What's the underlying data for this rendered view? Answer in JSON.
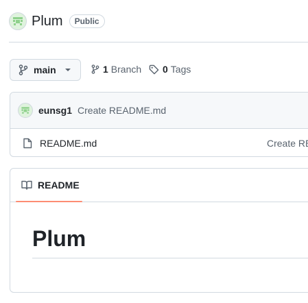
{
  "repo": {
    "name": "Plum",
    "visibility": "Public"
  },
  "branch": {
    "current": "main",
    "branch_count": "1",
    "branch_label": "Branch",
    "tag_count": "0",
    "tag_label": "Tags"
  },
  "latest_commit": {
    "author": "eunsg1",
    "message": "Create README.md"
  },
  "files": [
    {
      "name": "README.md",
      "commit": "Create README.md"
    }
  ],
  "readme": {
    "tab_label": "README",
    "title": "Plum"
  },
  "colors": {
    "accent_underline": "#fd8c73",
    "avatar_bg": "#dff3dd"
  },
  "icons": {
    "branch": "git-branch-icon",
    "tag": "tag-icon",
    "file": "file-icon",
    "book": "book-icon",
    "chevron": "chevron-down-icon"
  }
}
